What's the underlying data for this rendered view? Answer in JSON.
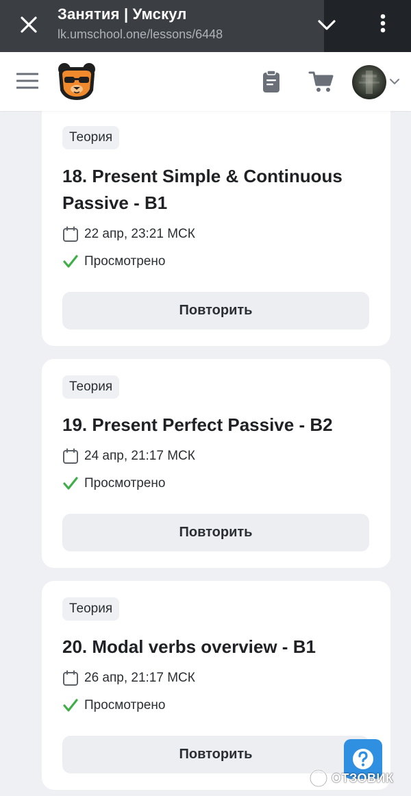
{
  "browser": {
    "title": "Занятия | Умскул",
    "url": "lk.umschool.one/lessons/6448"
  },
  "header": {
    "icons": [
      "menu-icon",
      "bear-logo",
      "clipboard-icon",
      "cart-icon",
      "avatar",
      "chevron-down-icon"
    ]
  },
  "lessons": [
    {
      "tag": "Теория",
      "title": "18. Present Simple & Continuous Passive - B1",
      "date": "22 апр, 23:21 МСК",
      "status": "Просмотрено",
      "button": "Повторить"
    },
    {
      "tag": "Теория",
      "title": "19. Present Perfect Passive - B2",
      "date": "24 апр, 21:17 МСК",
      "status": "Просмотрено",
      "button": "Повторить"
    },
    {
      "tag": "Теория",
      "title": "20. Modal verbs overview - B1",
      "date": "26 апр, 21:17 МСК",
      "status": "Просмотрено",
      "button": "Повторить"
    }
  ],
  "help": {
    "icon": "question-icon"
  },
  "watermark": {
    "text": "ОТЗОВИК"
  },
  "colors": {
    "browser_bar": "#3b3f44",
    "accent_orange": "#f08a2c",
    "check_green": "#3fae49",
    "help_blue": "#2f8fe0",
    "page_bg": "#eef0f4"
  }
}
